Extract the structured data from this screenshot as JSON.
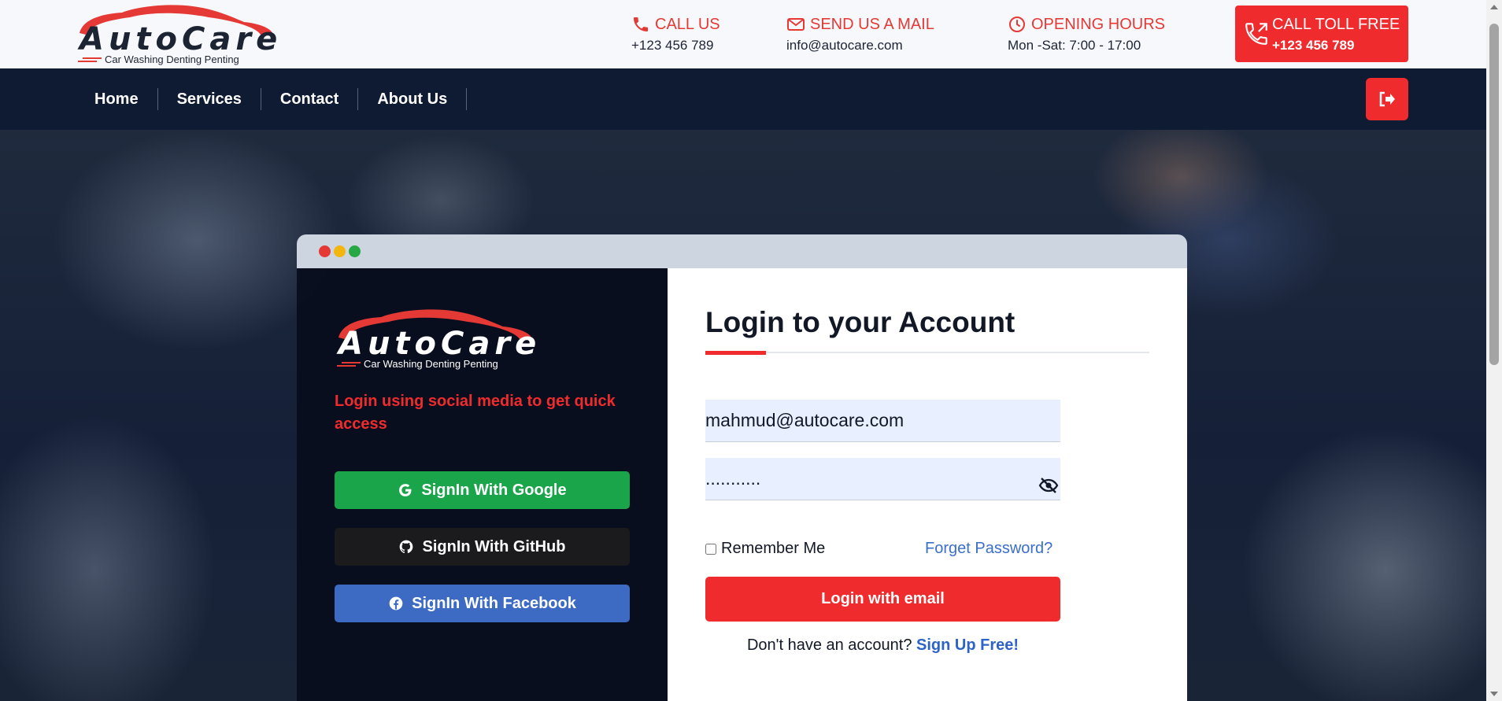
{
  "brand": {
    "name": "AutoCare",
    "tagline": "Car Washing Denting Penting"
  },
  "contact": {
    "call": {
      "label": "CALL US",
      "value": "+123 456 789",
      "icon": "phone-icon"
    },
    "mail": {
      "label": "SEND US A MAIL",
      "value": "info@autocare.com",
      "icon": "mail-icon"
    },
    "hours": {
      "label": "OPENING HOURS",
      "value": "Mon -Sat: 7:00 - 17:00",
      "icon": "clock-icon"
    },
    "toll": {
      "label": "CALL TOLL FREE",
      "value": "+123 456 789",
      "icon": "phone-outgoing-icon"
    }
  },
  "nav": {
    "items": [
      {
        "label": "Home"
      },
      {
        "label": "Services"
      },
      {
        "label": "Contact"
      },
      {
        "label": "About Us"
      }
    ],
    "logout_icon": "logout-icon"
  },
  "login": {
    "social_prompt": "Login using social media to get quick access",
    "social_buttons": [
      {
        "label": "SignIn With Google",
        "icon": "google-icon",
        "color": "#1aa54b"
      },
      {
        "label": "SignIn With GitHub",
        "icon": "github-icon",
        "color": "#1b1b1d"
      },
      {
        "label": "SignIn With Facebook",
        "icon": "facebook-icon",
        "color": "#3d6bc4"
      }
    ],
    "title": "Login to your Account",
    "email_value": "mahmud@autocare.com",
    "password_value": "...........",
    "remember_label": "Remember Me",
    "forgot_label": "Forget Password?",
    "submit_label": "Login with email",
    "signup_prompt": "Don't have an account?",
    "signup_link": "Sign Up Free!"
  },
  "colors": {
    "accent": "#ef2b2d",
    "nav_bg": "#0f1a33",
    "link": "#2c63c7",
    "input_bg": "#e8effe",
    "window_dots": [
      "#e53935",
      "#f2b60f",
      "#27a845"
    ]
  }
}
